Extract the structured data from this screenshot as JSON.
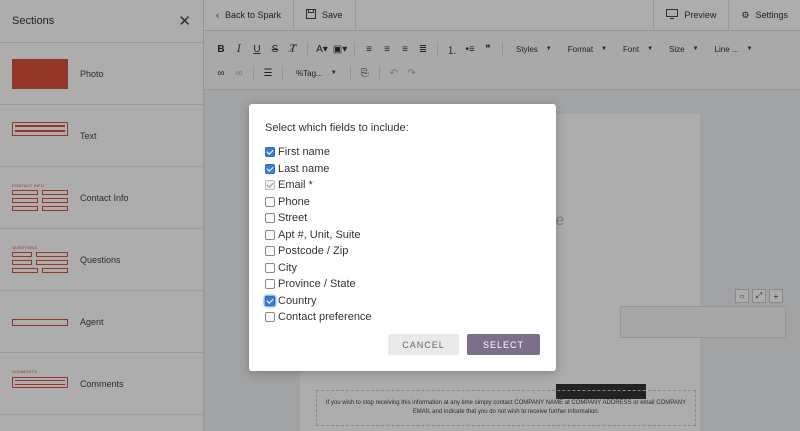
{
  "sidebar": {
    "title": "Sections",
    "close_icon": "close-icon",
    "items": [
      {
        "label": "Photo",
        "thumb": "photo"
      },
      {
        "label": "Text",
        "thumb": "text"
      },
      {
        "label": "Contact Info",
        "thumb": "contact",
        "thumb_caption": "CONTACT INFO"
      },
      {
        "label": "Questions",
        "thumb": "questions",
        "thumb_caption": "QUESTIONS"
      },
      {
        "label": "Agent",
        "thumb": "agent"
      },
      {
        "label": "Comments",
        "thumb": "comments",
        "thumb_caption": "COMMENTS"
      }
    ]
  },
  "topbar": {
    "back_label": "Back to Spark",
    "save_label": "Save",
    "preview_label": "Preview",
    "settings_label": "Settings"
  },
  "toolbar": {
    "styles_label": "Styles",
    "format_label": "Format",
    "font_label": "Font",
    "size_label": "Size",
    "line_label": "Line ...",
    "tag_label": "%Tag..."
  },
  "page": {
    "partial_text": "re",
    "footer_text": "If you wish to stop receiving this information at any time simply contact COMPANY NAME at COMPANY ADDRESS or email COMPANY EMAIL and indicate that you do not wish to receive further information."
  },
  "modal": {
    "title": "Select which fields to include:",
    "fields": [
      {
        "label": "First name",
        "checked": true
      },
      {
        "label": "Last name",
        "checked": true
      },
      {
        "label": "Email *",
        "checked": true,
        "disabled": true
      },
      {
        "label": "Phone",
        "checked": false
      },
      {
        "label": "Street",
        "checked": false
      },
      {
        "label": "Apt #, Unit, Suite",
        "checked": false
      },
      {
        "label": "Postcode / Zip",
        "checked": false
      },
      {
        "label": "City",
        "checked": false
      },
      {
        "label": "Province / State",
        "checked": false
      },
      {
        "label": "Country",
        "checked": true,
        "focused": true
      },
      {
        "label": "Contact preference",
        "checked": false
      }
    ],
    "cancel_label": "CANCEL",
    "select_label": "SELECT"
  },
  "colors": {
    "accent_red": "#d9533b",
    "checkbox_blue": "#3b7fd4",
    "select_button": "#7c6f8a"
  }
}
